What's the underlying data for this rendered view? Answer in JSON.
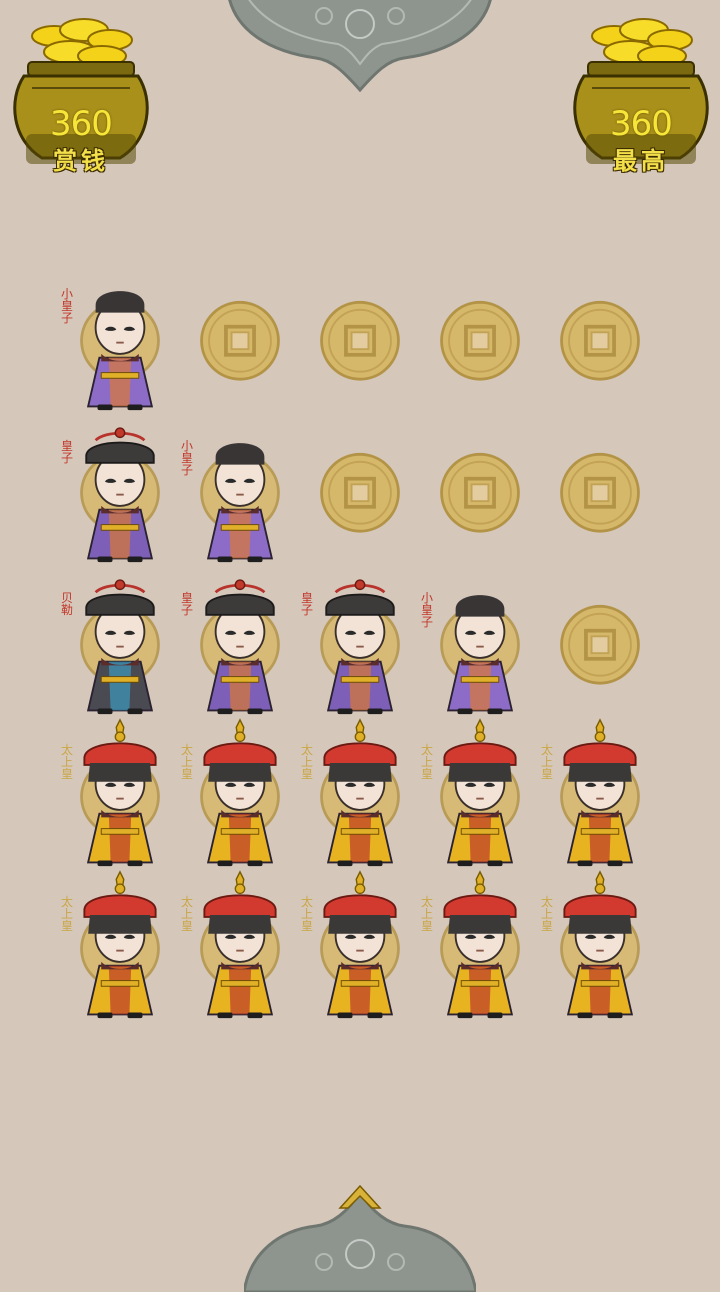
{
  "reward": {
    "value": "360",
    "label": "赏钱"
  },
  "best": {
    "value": "360",
    "label": "最高"
  },
  "board": {
    "rows": [
      [
        "xiaohuangzi",
        "coin",
        "coin",
        "coin",
        "coin"
      ],
      [
        "huangzi",
        "xiaohuangzi",
        "coin",
        "coin",
        "coin"
      ],
      [
        "beile",
        "huangzi",
        "huangzi",
        "xiaohuangzi",
        "coin"
      ],
      [
        "taishanghuang",
        "taishanghuang",
        "taishanghuang",
        "taishanghuang",
        "taishanghuang"
      ],
      [
        "taishanghuang",
        "taishanghuang",
        "taishanghuang",
        "taishanghuang",
        "taishanghuang"
      ]
    ]
  },
  "ranks": {
    "xiaohuangzi": {
      "label": "小皇子",
      "seal": "red",
      "robe": "#8d6cc8",
      "hat": "none"
    },
    "huangzi": {
      "label": "皇子",
      "seal": "red",
      "robe": "#7d5fb8",
      "hat": "official"
    },
    "beile": {
      "label": "贝勒",
      "seal": "red",
      "robe": "#4a4a52",
      "hat": "official"
    },
    "taishanghuang": {
      "label": "太上皇",
      "seal": "gold",
      "robe": "#e8b321",
      "hat": "emperor"
    }
  },
  "colors": {
    "background": "#d6c7bb",
    "coin": "#d6b86a",
    "gold": "#f6e63a"
  }
}
